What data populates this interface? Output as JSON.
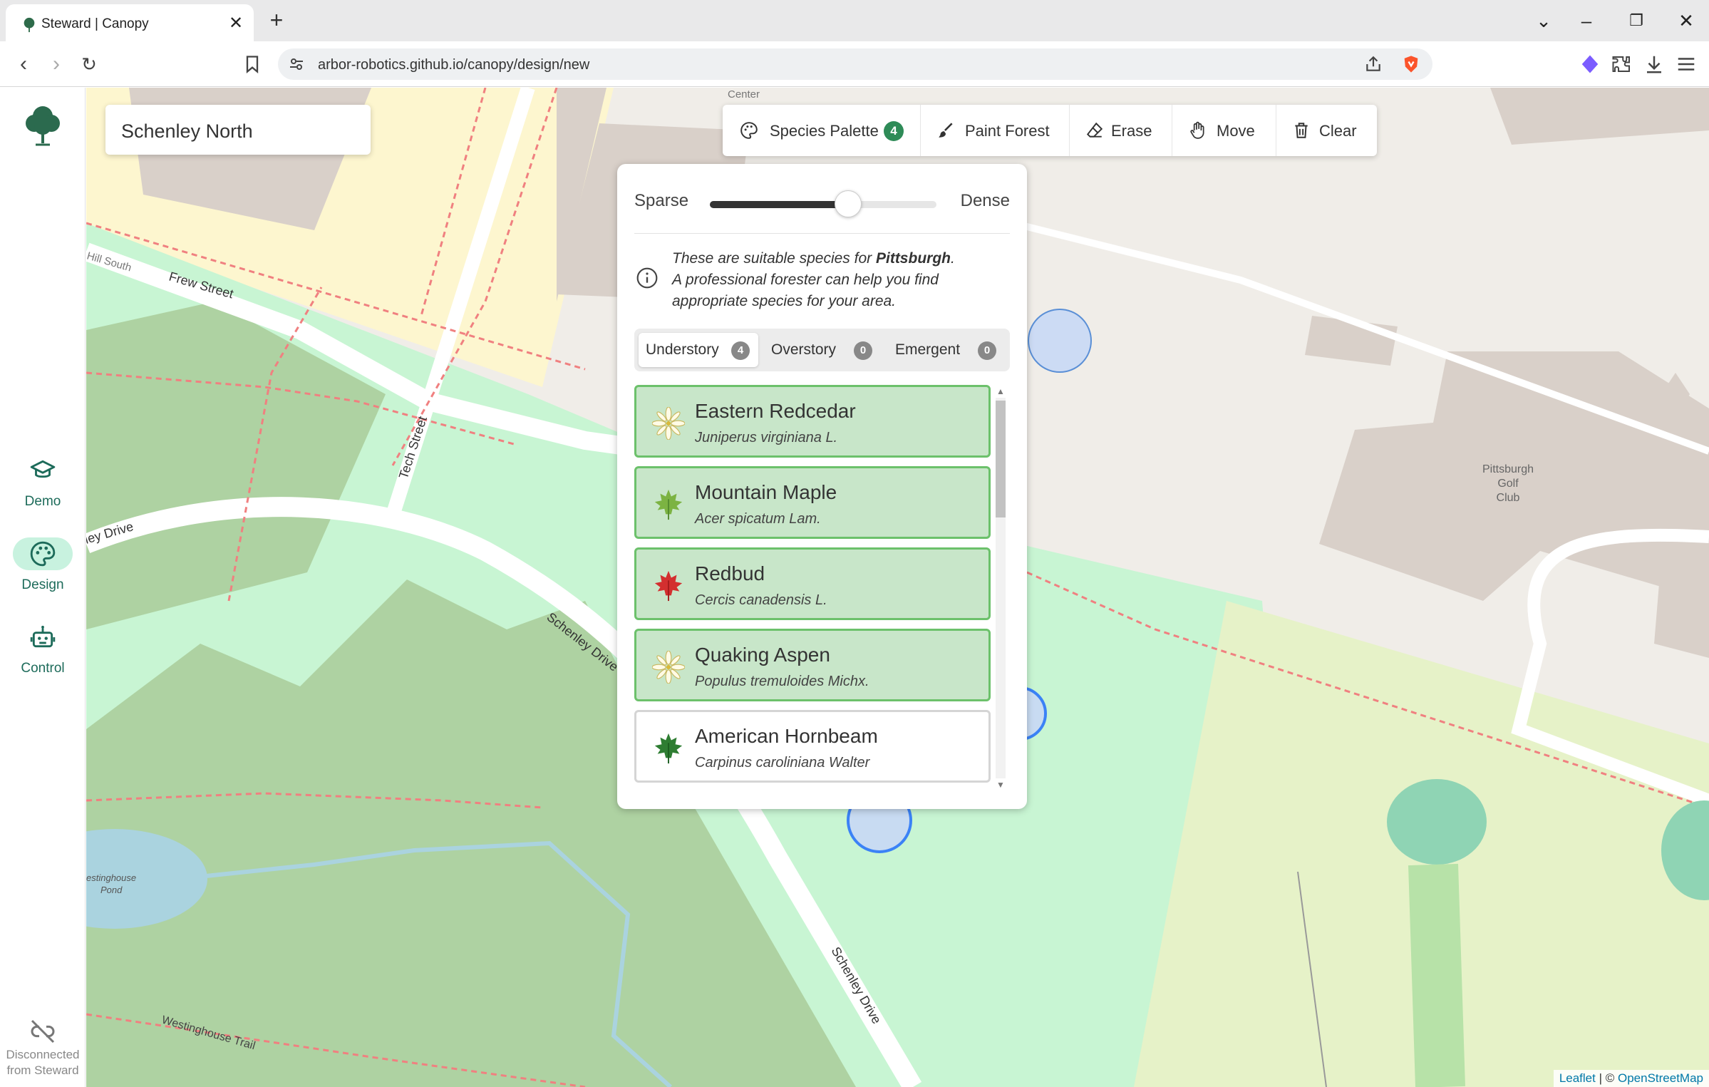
{
  "browser": {
    "tab_title": "Steward | Canopy",
    "url": "arbor-robotics.github.io/canopy/design/new",
    "new_tab_symbol": "+",
    "close_symbol": "✕"
  },
  "rail": {
    "nav": [
      {
        "label": "Demo",
        "icon": "mortarboard-icon",
        "active": false
      },
      {
        "label": "Design",
        "icon": "palette-icon",
        "active": true
      },
      {
        "label": "Control",
        "icon": "robot-icon",
        "active": false
      }
    ],
    "status_line1": "Disconnected",
    "status_line2": "from Steward"
  },
  "location": {
    "name": "Schenley North"
  },
  "toolbar": {
    "species_palette": "Species Palette",
    "species_count": "4",
    "paint": "Paint Forest",
    "erase": "Erase",
    "move": "Move",
    "clear": "Clear"
  },
  "palette": {
    "density_min_label": "Sparse",
    "density_max_label": "Dense",
    "density_value": 0.61,
    "info_prefix": "These are suitable species for ",
    "info_city": "Pittsburgh",
    "info_suffix": ".",
    "info_line2": "A professional forester can help you find appropriate species for your area.",
    "tabs": [
      {
        "label": "Understory",
        "count": "4",
        "active": true
      },
      {
        "label": "Overstory",
        "count": "0",
        "active": false
      },
      {
        "label": "Emergent",
        "count": "0",
        "active": false
      }
    ],
    "species": [
      {
        "common": "Eastern Redcedar",
        "scientific": "Juniperus virginiana L.",
        "selected": true,
        "icon": "white-flower-icon"
      },
      {
        "common": "Mountain Maple",
        "scientific": "Acer spicatum Lam.",
        "selected": true,
        "icon": "green-maple-leaf-icon"
      },
      {
        "common": "Redbud",
        "scientific": "Cercis canadensis L.",
        "selected": true,
        "icon": "red-maple-leaf-icon"
      },
      {
        "common": "Quaking Aspen",
        "scientific": "Populus tremuloides Michx.",
        "selected": true,
        "icon": "white-flower-icon"
      },
      {
        "common": "American Hornbeam",
        "scientific": "Carpinus caroliniana Walter",
        "selected": false,
        "icon": "dark-green-leaf-icon"
      }
    ]
  },
  "map": {
    "labels": {
      "frew": "Frew Street",
      "tech": "Tech Street",
      "schenley1": "Schenley Drive",
      "schenley2": "Schenley Drive",
      "ley": "ley Drive",
      "hill": "Hill South",
      "center": "Center",
      "westinghouse_trail": "Westinghouse Trail",
      "pond1": "estinghouse",
      "pond2": "Pond",
      "golf1": "Pittsburgh",
      "golf2": "Golf",
      "golf3": "Club"
    },
    "attribution_leaflet": "Leaflet",
    "attribution_sep": " | © ",
    "attribution_osm": "OpenStreetMap"
  },
  "colors": {
    "accent": "#1d6b5a",
    "active_nav_bg": "#c8f2df",
    "selected_card_bg": "#c8e6c9",
    "selected_card_border": "#6cc16b",
    "badge_green": "#2e8b57"
  }
}
